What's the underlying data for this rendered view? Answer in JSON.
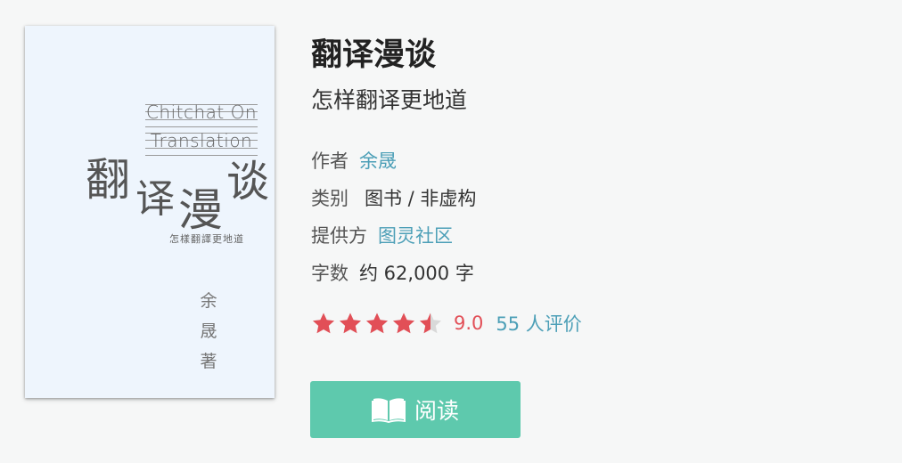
{
  "cover": {
    "english_line1": "Chitchat On",
    "english_line2": "Translation",
    "title_chars": [
      "翻",
      "译",
      "漫",
      "谈"
    ],
    "subtitle": "怎樣翻譯更地道",
    "author_chars": [
      "余",
      "晟",
      "著"
    ]
  },
  "book": {
    "title": "翻译漫谈",
    "subtitle": "怎样翻译更地道"
  },
  "meta": {
    "author_label": "作者",
    "author_value": "余晟",
    "category_label": "类别",
    "category_value": "图书 / 非虚构",
    "provider_label": "提供方",
    "provider_value": "图灵社区",
    "wordcount_label": "字数",
    "wordcount_value": "约 62,000 字"
  },
  "rating": {
    "stars": 4.5,
    "score": "9.0",
    "count_text": "55 人评价",
    "star_color": "#e24f57"
  },
  "actions": {
    "read_label": "阅读",
    "read_icon": "open-book-icon",
    "button_color": "#5ec9ad"
  }
}
